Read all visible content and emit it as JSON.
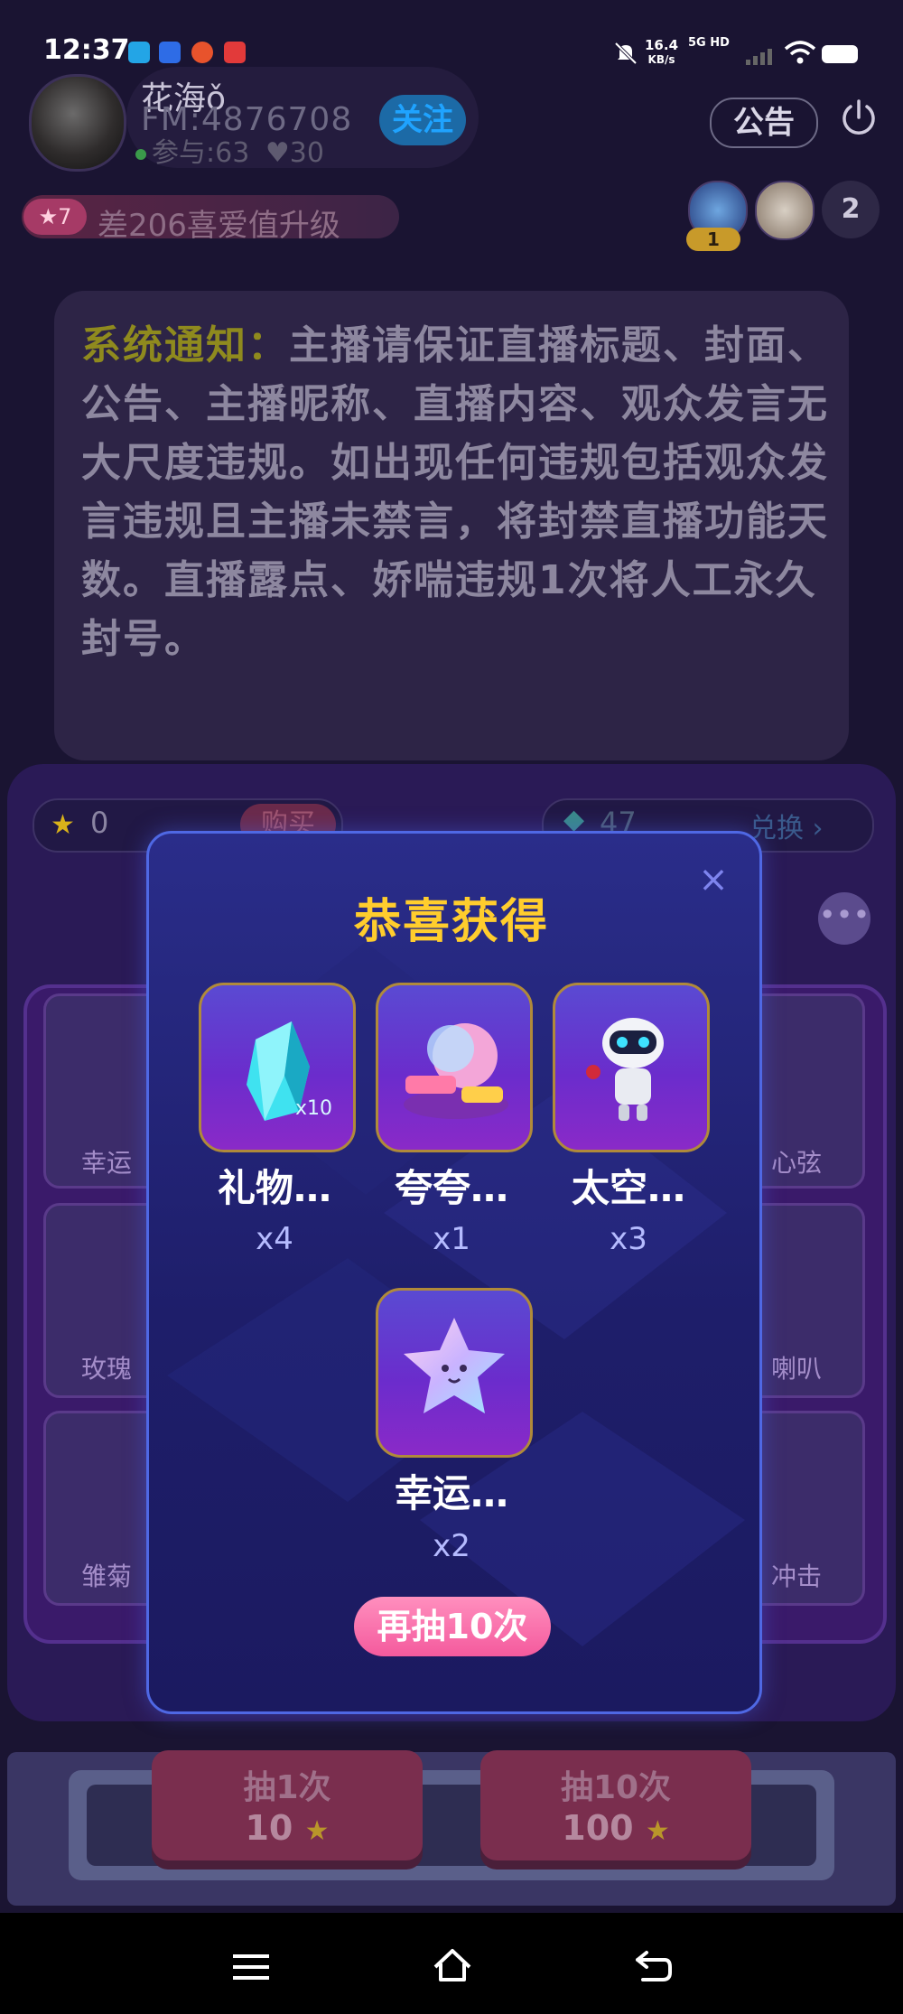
{
  "status_bar": {
    "time": "12:37",
    "network_speed": "16.4",
    "network_unit": "KB/s",
    "signal": "5G HD",
    "icons": [
      "bilibili-icon",
      "baidu-icon",
      "weibo-icon",
      "red-app-icon",
      "mute-icon",
      "signal-icon",
      "wifi-icon",
      "battery-icon"
    ]
  },
  "header": {
    "host_name": "花海ǒ",
    "host_id": "FM:4876708",
    "participants": "参与:63",
    "likes": "30",
    "follow_label": "关注",
    "notice_label": "公告",
    "level": "7",
    "level_text": "差206喜爱值升级",
    "viewer_rank": "1",
    "viewer_count": "2"
  },
  "system_notice": {
    "label": "系统通知：",
    "text": "主播请保证直播标题、封面、公告、主播昵称、直播内容、观众发言无大尺度违规。如出现任何违规包括观众发言违规且主播未禁言，将封禁直播功能天数。直播露点、娇喘违规1次将人工永久封号。"
  },
  "game": {
    "star_count": "0",
    "buy_label": "购买",
    "gem_count": "47",
    "exchange_label": "兑换",
    "more_label": "•••",
    "background_cards": [
      "幸运",
      "心弦",
      "玫瑰",
      "喇叭",
      "雏菊",
      "冲击"
    ],
    "draw_buttons": [
      {
        "label": "抽1次",
        "cost": "10"
      },
      {
        "label": "抽10次",
        "cost": "100"
      }
    ]
  },
  "modal": {
    "title": "恭喜获得",
    "close_label": "×",
    "prizes": [
      {
        "name": "礼物…",
        "count": "x4",
        "badge": "x10",
        "icon": "crystal-icon"
      },
      {
        "name": "夸夸…",
        "count": "x1",
        "badge": "",
        "icon": "praise-bubble-icon"
      },
      {
        "name": "太空…",
        "count": "x3",
        "badge": "",
        "icon": "space-robot-icon"
      },
      {
        "name": "幸运…",
        "count": "x2",
        "badge": "",
        "icon": "lucky-star-icon"
      }
    ],
    "again_label": "再抽10次"
  },
  "nav_bar": {
    "icons": [
      "menu-icon",
      "home-icon",
      "back-icon"
    ]
  },
  "colors": {
    "modal_title": "#ffcd2d",
    "modal_border": "#4f68e4",
    "again_button": "#f45a9d",
    "follow": "#1fa3ff"
  }
}
